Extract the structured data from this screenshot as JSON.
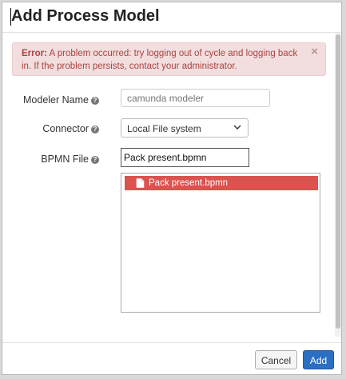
{
  "dialog": {
    "title": "Add Process Model"
  },
  "alert": {
    "prefix": "Error:",
    "message": "A problem occurred: try logging out of cycle and logging back in. If the problem persists, contact your administrator.",
    "close_glyph": "×"
  },
  "form": {
    "modeler_name": {
      "label": "Modeler Name",
      "help_glyph": "?",
      "placeholder": "camunda modeler",
      "value": ""
    },
    "connector": {
      "label": "Connector",
      "help_glyph": "?",
      "selected": "Local File system"
    },
    "bpmn_file": {
      "label": "BPMN File",
      "help_glyph": "?",
      "value": "Pack present.bpmn",
      "list_items": [
        "Pack present.bpmn"
      ]
    }
  },
  "footer": {
    "cancel_label": "Cancel",
    "add_label": "Add"
  },
  "colors": {
    "alert_bg": "#f2dede",
    "alert_text": "#a94442",
    "selected_item": "#d9534f",
    "primary": "#2b6fc2"
  },
  "icons": [
    "help-icon",
    "close-icon",
    "chevron-down-icon",
    "document-icon"
  ]
}
